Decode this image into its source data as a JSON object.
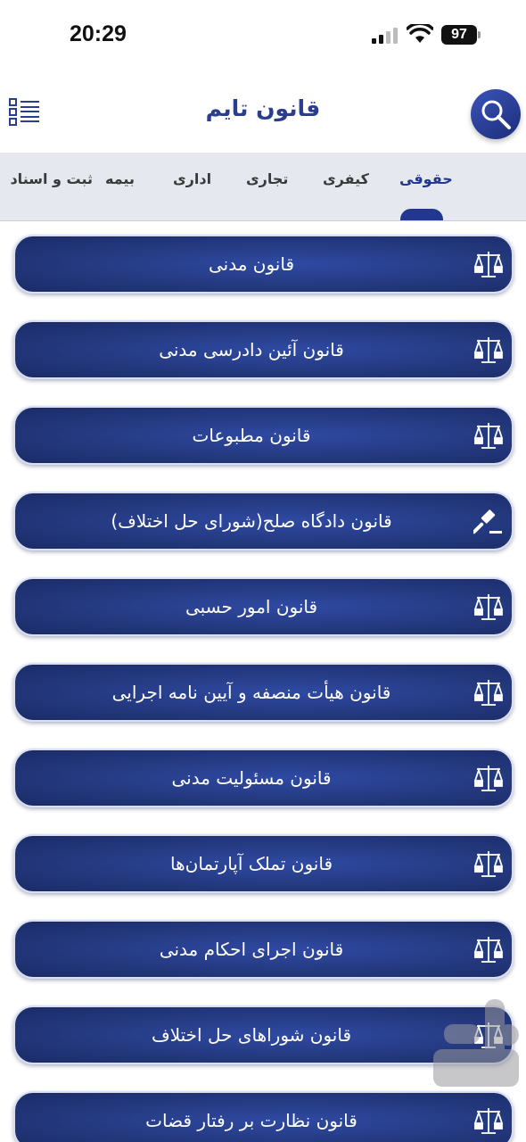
{
  "status_bar": {
    "time": "20:29",
    "battery": "97"
  },
  "header": {
    "title": "قانون تایم",
    "icons": {
      "menu": "list-menu-icon",
      "search": "search-icon"
    }
  },
  "tabs": [
    {
      "label": "حقوقی",
      "active": true
    },
    {
      "label": "کیفری",
      "active": false
    },
    {
      "label": "تجاری",
      "active": false
    },
    {
      "label": "اداری",
      "active": false
    },
    {
      "label": "بیمه",
      "active": false
    },
    {
      "label": "ثبت و اسناد",
      "active": false
    }
  ],
  "laws": [
    {
      "label": "قانون مدنی",
      "icon": "scales-icon"
    },
    {
      "label": "قانون آئین دادرسی مدنی",
      "icon": "scales-icon"
    },
    {
      "label": "قانون مطبوعات",
      "icon": "scales-icon"
    },
    {
      "label": "قانون دادگاه صلح(شورای حل اختلاف)",
      "icon": "gavel-icon"
    },
    {
      "label": "قانون امور حسبی",
      "icon": "scales-icon"
    },
    {
      "label": "قانون هیأت منصفه و آیین نامه اجرایی",
      "icon": "scales-icon"
    },
    {
      "label": "قانون مسئولیت مدنی",
      "icon": "scales-icon"
    },
    {
      "label": "قانون تملک آپارتمان‌ها",
      "icon": "scales-icon"
    },
    {
      "label": "قانون اجرای احکام مدنی",
      "icon": "scales-icon"
    },
    {
      "label": "قانون شوراهای حل اختلاف",
      "icon": "scales-icon"
    },
    {
      "label": "قانون نظارت بر رفتار قضات",
      "icon": "scales-icon"
    }
  ],
  "colors": {
    "primary": "#22378f",
    "tab_bar": "#e6e8ef",
    "item_bg": "#24397f"
  }
}
